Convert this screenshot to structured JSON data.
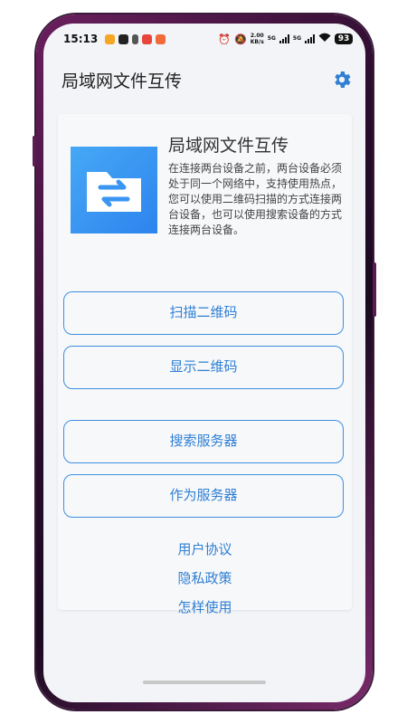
{
  "status_bar": {
    "time": "15:13",
    "net_speed_value": "2.00",
    "net_speed_unit": "KB/s",
    "network_tag": "5G",
    "battery": "93"
  },
  "app_bar": {
    "title": "局域网文件互传",
    "settings_icon": "gear-icon"
  },
  "intro": {
    "icon": "file-transfer-icon",
    "title": "局域网文件互传",
    "description": "在连接两台设备之前，两台设备必须处于同一个网络中，支持使用热点，您可以使用二维码扫描的方式连接两台设备，也可以使用搜索设备的方式连接两台设备。"
  },
  "actions": {
    "scan_qr": "扫描二维码",
    "show_qr": "显示二维码",
    "search_server": "搜索服务器",
    "as_server": "作为服务器"
  },
  "links": {
    "user_agreement": "用户协议",
    "privacy_policy": "隐私政策",
    "how_to_use": "怎样使用"
  },
  "colors": {
    "accent": "#2f7fd4",
    "icon_bg": "#3a96f2"
  }
}
